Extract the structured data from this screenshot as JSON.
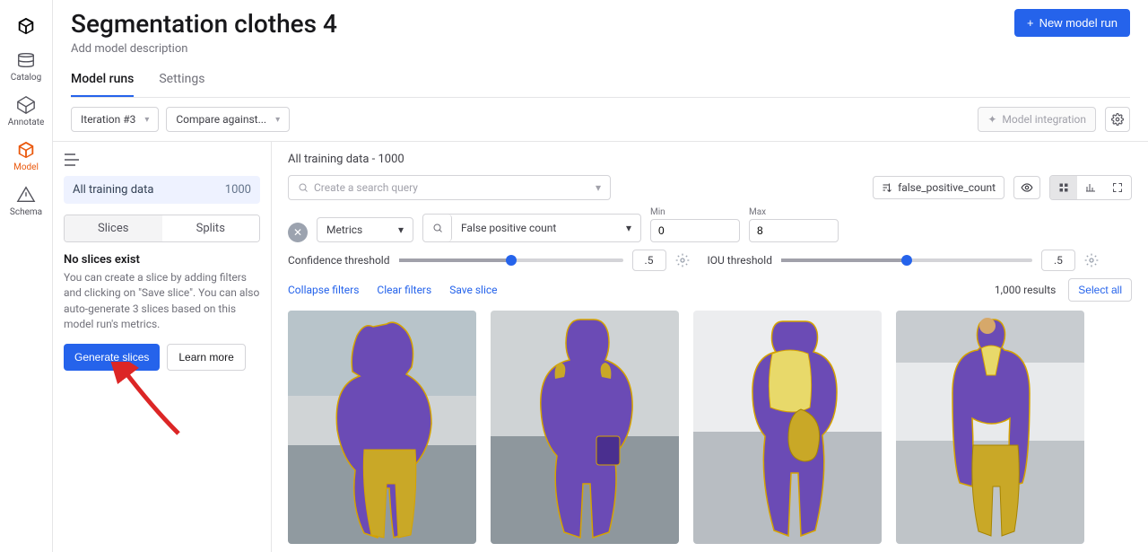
{
  "page": {
    "title": "Segmentation clothes 4",
    "description_placeholder": "Add model description"
  },
  "header_actions": {
    "new_run": "New model run"
  },
  "rail": {
    "items": [
      {
        "label": "Catalog"
      },
      {
        "label": "Annotate"
      },
      {
        "label": "Model"
      },
      {
        "label": "Schema"
      }
    ]
  },
  "tabs": [
    {
      "label": "Model runs",
      "active": true
    },
    {
      "label": "Settings",
      "active": false
    }
  ],
  "toolbar": {
    "iteration": "Iteration #3",
    "compare": "Compare against...",
    "integration": "Model integration"
  },
  "sidebar": {
    "training_label": "All training data",
    "training_count": "1000",
    "pills": [
      {
        "label": "Slices",
        "active": true
      },
      {
        "label": "Splits",
        "active": false
      }
    ],
    "empty_title": "No slices exist",
    "empty_text": "You can create a slice by adding filters and clicking on \"Save slice\". You can also auto-generate 3 slices based on this model run's metrics.",
    "generate_btn": "Generate slices",
    "learn_btn": "Learn more"
  },
  "results": {
    "title": "All training data - 1000",
    "search_placeholder": "Create a search query",
    "sort_field": "false_positive_count",
    "metric_label": "Metrics",
    "fp_label": "False positive count",
    "min_label": "Min",
    "min_value": "0",
    "max_label": "Max",
    "max_value": "8",
    "conf_label": "Confidence threshold",
    "conf_value": ".5",
    "iou_label": "IOU threshold",
    "iou_value": ".5",
    "collapse": "Collapse filters",
    "clear": "Clear filters",
    "save": "Save slice",
    "count": "1,000 results",
    "select_all": "Select all"
  },
  "colors": {
    "mask_purple": "#6b4bb5",
    "mask_gold": "#c9a827",
    "outline": "#d6a300"
  }
}
